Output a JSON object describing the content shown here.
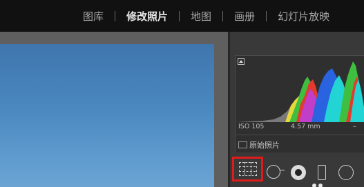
{
  "topbar": {
    "modules": [
      {
        "label": "图库",
        "active": false
      },
      {
        "label": "修改照片",
        "active": true
      },
      {
        "label": "地图",
        "active": false
      },
      {
        "label": "画册",
        "active": false
      },
      {
        "label": "幻灯片放映",
        "active": false
      }
    ]
  },
  "histogram": {
    "clipping_icon": "shadow-clipping-icon",
    "colors": {
      "red": "#e23a2e",
      "green": "#3fbf3f",
      "blue": "#2a63e0",
      "cyan": "#22d4d4",
      "yellow": "#e8d93a",
      "magenta": "#c03ec8",
      "gray": "#9a9a9a"
    }
  },
  "exif": {
    "iso": "ISO 105",
    "focal_length": "4.57 mm",
    "aperture": "–"
  },
  "original_photo": {
    "label": "原始照片"
  },
  "tools": [
    {
      "name": "crop-overlay-icon",
      "selected": true,
      "highlight_color": "#e11b1b"
    },
    {
      "name": "spot-removal-icon"
    },
    {
      "name": "red-eye-correction-icon"
    },
    {
      "name": "graduated-filter-icon"
    },
    {
      "name": "radial-filter-icon"
    }
  ]
}
